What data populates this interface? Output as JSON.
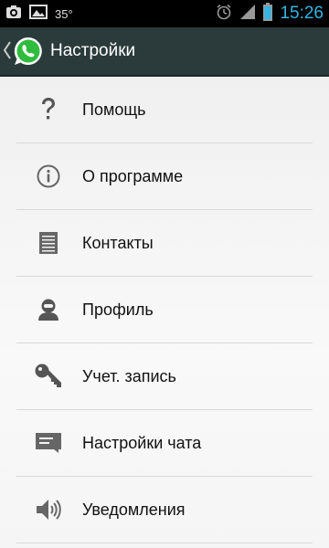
{
  "status_bar": {
    "temperature": "35°",
    "time": "15:26",
    "icons": [
      "camera-icon",
      "gallery-icon",
      "alarm-icon",
      "signal-icon",
      "battery-icon"
    ]
  },
  "action_bar": {
    "title": "Настройки",
    "logo": "whatsapp-logo",
    "back": "chevron-left-icon",
    "background": "#2b3b3b"
  },
  "settings": {
    "items": [
      {
        "label": "Помощь",
        "icon": "help-icon"
      },
      {
        "label": "О программе",
        "icon": "info-icon"
      },
      {
        "label": "Контакты",
        "icon": "contacts-icon"
      },
      {
        "label": "Профиль",
        "icon": "profile-icon"
      },
      {
        "label": "Учет. запись",
        "icon": "key-icon"
      },
      {
        "label": "Настройки чата",
        "icon": "chat-settings-icon"
      },
      {
        "label": "Уведомления",
        "icon": "notifications-icon"
      }
    ]
  },
  "accent_color": "#33b5e5"
}
